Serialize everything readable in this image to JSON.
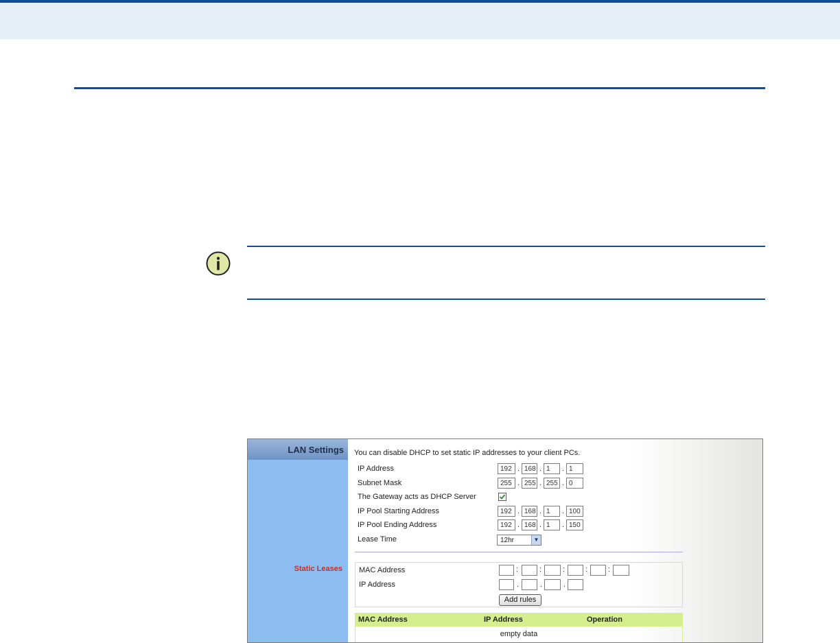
{
  "lan": {
    "sidebar_title": "LAN Settings",
    "static_leases_label": "Static Leases",
    "intro": "You can disable DHCP to set static IP addresses to your client PCs.",
    "ip_address_label": "IP Address",
    "ip_address": [
      "192",
      "168",
      "1",
      "1"
    ],
    "subnet_mask_label": "Subnet Mask",
    "subnet_mask": [
      "255",
      "255",
      "255",
      "0"
    ],
    "dhcp_label": "The Gateway acts as DHCP Server",
    "dhcp_enabled": true,
    "pool_start_label": "IP Pool Starting Address",
    "pool_start": [
      "192",
      "168",
      "1",
      "100"
    ],
    "pool_end_label": "IP Pool Ending Address",
    "pool_end": [
      "192",
      "168",
      "1",
      "150"
    ],
    "lease_time_label": "Lease Time",
    "lease_time": "12hr"
  },
  "static_leases": {
    "mac_label": "MAC Address",
    "ip_label": "IP Address",
    "mac": [
      "",
      "",
      "",
      "",
      "",
      ""
    ],
    "ip": [
      "",
      "",
      "",
      ""
    ],
    "add_button": "Add rules",
    "columns": [
      "MAC Address",
      "IP Address",
      "Operation"
    ],
    "empty_text": "empty data"
  },
  "colors": {
    "accent": "#0f4d99",
    "sidebar": "#8dbcf0",
    "table_header": "#d6ef8e",
    "static_leases": "#d42a1f"
  },
  "icons": {
    "note": "info-icon"
  }
}
